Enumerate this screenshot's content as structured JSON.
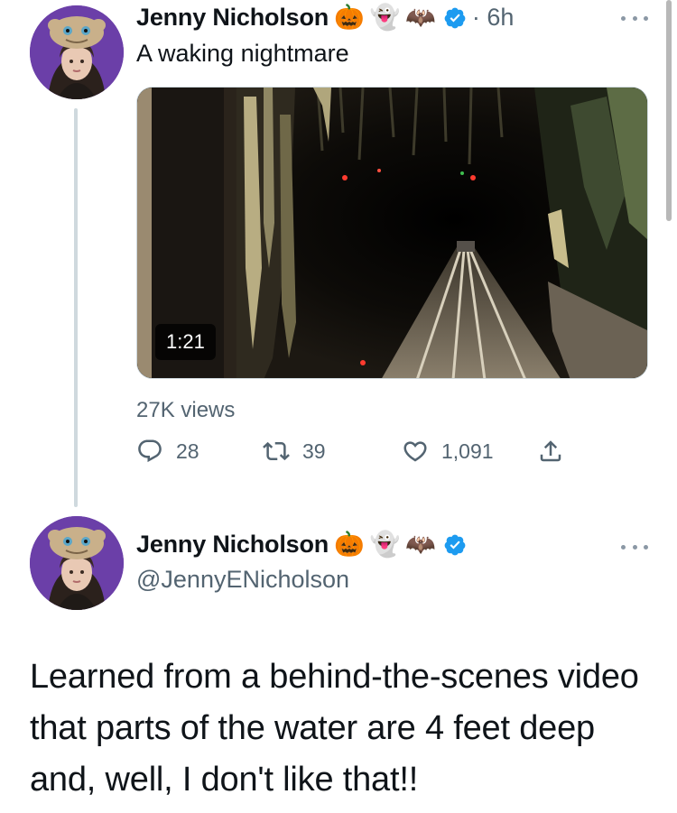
{
  "thread": {
    "first_tweet": {
      "author_name": "Jenny Nicholson",
      "name_emojis": [
        "🎃",
        "👻",
        "🦇"
      ],
      "timestamp": "· 6h",
      "text": "A waking nightmare",
      "video_duration": "1:21",
      "views": "27K views",
      "actions": {
        "replies": "28",
        "retweets": "39",
        "likes": "1,091"
      }
    },
    "main_tweet": {
      "author_name": "Jenny Nicholson",
      "name_emojis": [
        "🎃",
        "👻",
        "🦇"
      ],
      "handle": "@JennyENicholson",
      "text": "Learned from a behind-the-scenes video that parts of the water are 4 feet deep and, well, I don't like that!!"
    }
  },
  "colors": {
    "verified": "#1d9bf0",
    "secondary_text": "#536471",
    "thread_line": "#cfd9de",
    "avatar_background": "#6b3fa8"
  },
  "icons": {
    "verified": "verified-badge-icon",
    "more": "more-dots-icon",
    "reply": "reply-icon",
    "retweet": "retweet-icon",
    "like": "heart-icon",
    "share": "share-icon"
  }
}
